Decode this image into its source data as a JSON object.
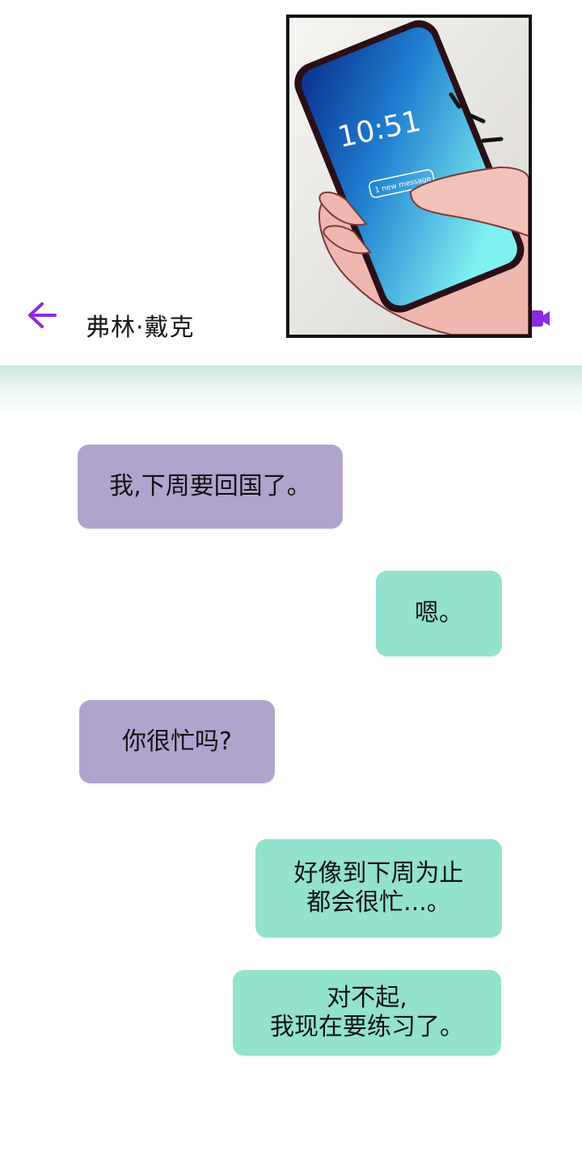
{
  "header": {
    "contact_name": "弗林·戴克",
    "back_icon": "arrow-left-icon",
    "video_icon": "video-camera-icon",
    "accent_color": "#8a2be2"
  },
  "phone_panel": {
    "lock_time": "10:51",
    "notification": "1 new message"
  },
  "messages": [
    {
      "side": "left",
      "color": "#b0a4cd",
      "lines": [
        "我,下周要回国了。"
      ]
    },
    {
      "side": "right",
      "color": "#92e2cd",
      "lines": [
        "嗯。"
      ]
    },
    {
      "side": "left",
      "color": "#b0a4cd",
      "lines": [
        "你很忙吗?"
      ]
    },
    {
      "side": "right",
      "color": "#92e2cd",
      "lines": [
        "好像到下周为止",
        "都会很忙...。"
      ]
    },
    {
      "side": "right",
      "color": "#92e2cd",
      "lines": [
        "对不起,",
        "我现在要练习了。"
      ]
    }
  ]
}
